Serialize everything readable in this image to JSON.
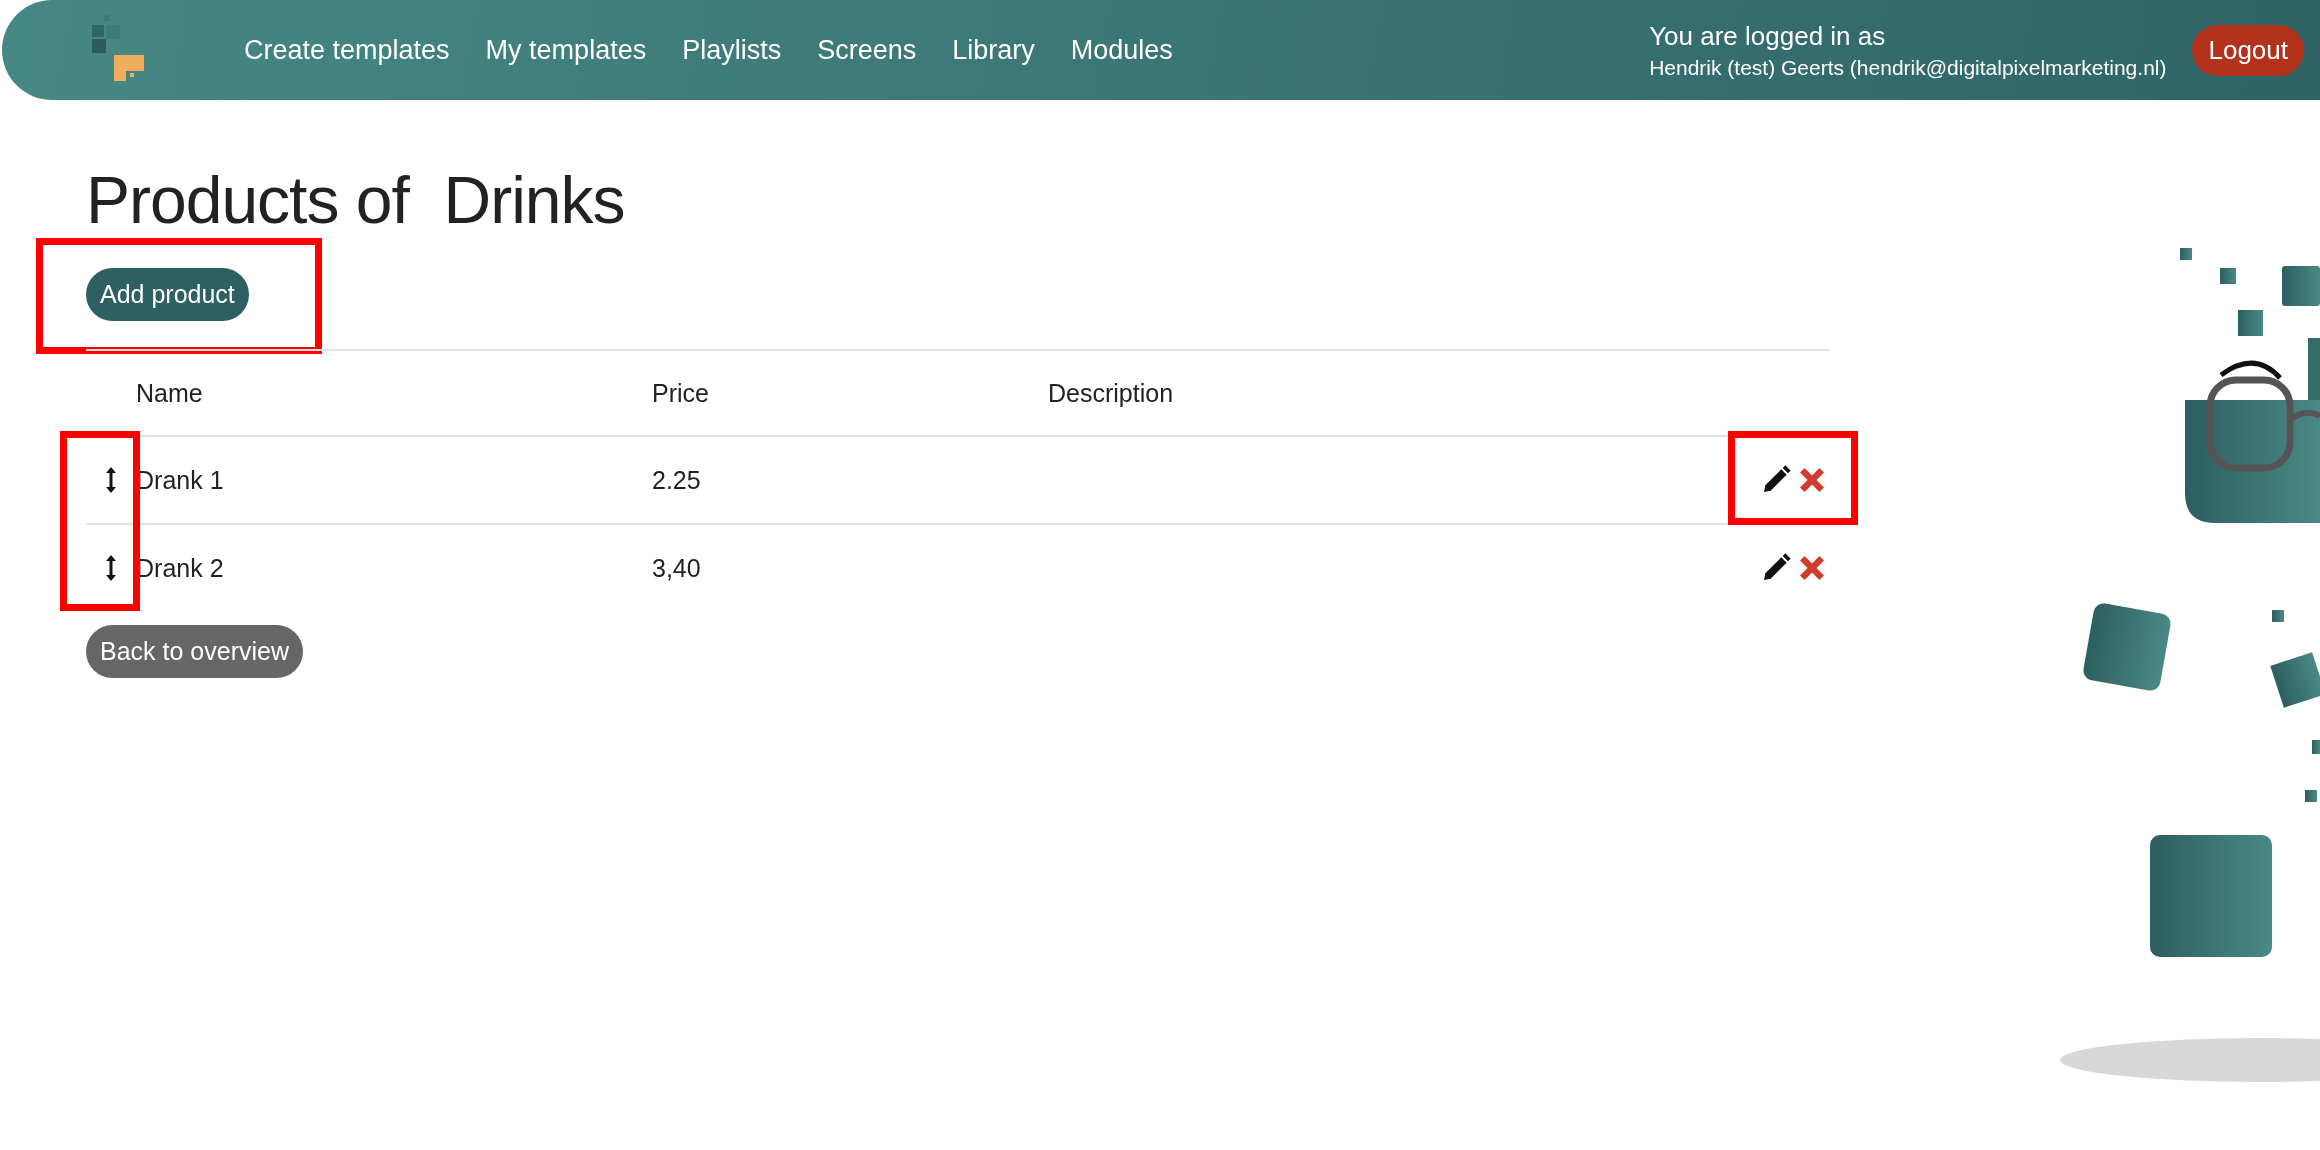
{
  "header": {
    "nav": [
      "Create templates",
      "My templates",
      "Playlists",
      "Screens",
      "Library",
      "Modules"
    ],
    "login_label": "You are logged in as",
    "user": "Hendrik (test) Geerts (hendrik@digitalpixelmarketing.nl)",
    "logout": "Logout"
  },
  "title": "Products of  Drinks",
  "add_button": "Add product",
  "table": {
    "columns": [
      "Name",
      "Price",
      "Description"
    ],
    "rows": [
      {
        "name": "Drank 1",
        "price": "2.25",
        "description": ""
      },
      {
        "name": "Drank 2",
        "price": "3,40",
        "description": ""
      }
    ]
  },
  "back_button": "Back to overview"
}
